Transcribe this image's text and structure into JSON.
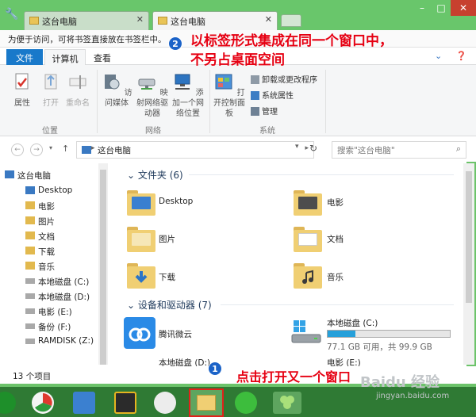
{
  "window": {
    "tabs": [
      {
        "label": "这台电脑",
        "close": "✕"
      },
      {
        "label": "这台电脑",
        "close": "✕"
      }
    ],
    "controls": {
      "minimize": "–",
      "maximize": "□",
      "close": "✕"
    },
    "hint": "为便于访问，可将书签直接放在书签栏中。"
  },
  "ribbon": {
    "tabs": {
      "file": "文件",
      "computer": "计算机",
      "view": "查看"
    },
    "buttons": {
      "properties": "属性",
      "open": "打开",
      "rename": "重命名",
      "access_media": "访问媒体",
      "map_drive": "映射网络驱动器",
      "add_location": "添加一个网络位置",
      "control_panel": "打开控制面板",
      "uninstall": "卸载或更改程序",
      "system_props": "系统属性",
      "manage": "管理"
    },
    "groups": {
      "location": "位置",
      "network": "网络",
      "system": "系统"
    }
  },
  "address": {
    "path": "这台电脑",
    "search_placeholder": "搜索\"这台电脑\""
  },
  "nav": {
    "items": [
      "这台电脑",
      "Desktop",
      "电影",
      "图片",
      "文档",
      "下载",
      "音乐",
      "本地磁盘 (C:)",
      "本地磁盘 (D:)",
      "电影 (E:)",
      "备份 (F:)",
      "RAMDISK (Z:)"
    ]
  },
  "content": {
    "folders_header": "文件夹 (6)",
    "folders": [
      "Desktop",
      "电影",
      "图片",
      "文档",
      "下载",
      "音乐"
    ],
    "devices_header": "设备和驱动器 (7)",
    "devices": [
      {
        "name": "腾讯微云"
      },
      {
        "name": "本地磁盘 (C:)",
        "free_text": "77.1 GB 可用，共 99.9 GB",
        "used_fraction": 0.23
      },
      {
        "name": "本地磁盘 (D:)"
      },
      {
        "name": "电影 (E:)"
      }
    ]
  },
  "status": {
    "count": "13 个项目"
  },
  "annotations": {
    "badge1": "1",
    "badge2": "2",
    "text_top": "以标签形式集成在同一个窗口中，不另占桌面空间",
    "text_bottom": "点击打开又一个窗口"
  },
  "watermark": {
    "brand": "Baidu 经验",
    "url": "jingyan.baidu.com"
  },
  "colors": {
    "accent": "#1979ca",
    "annotation": "#e60012",
    "titlebar": "#69c66b",
    "taskbar": "#2f7a34"
  }
}
